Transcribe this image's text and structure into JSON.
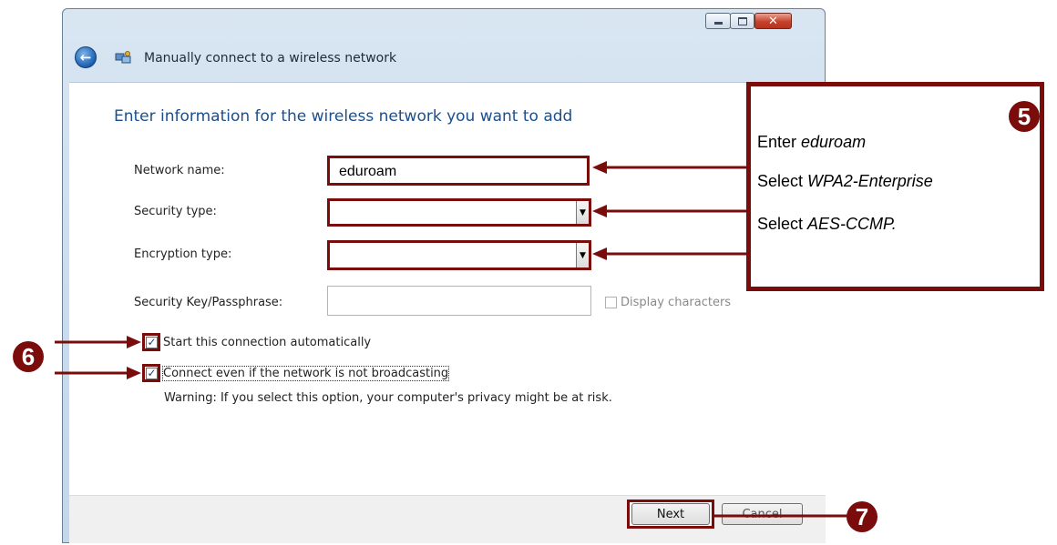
{
  "window": {
    "title": "Manually connect to a wireless network",
    "controls": {
      "minimize": "",
      "maximize": "",
      "close": "✕"
    }
  },
  "form": {
    "heading": "Enter information for the wireless network you want to add",
    "network_name_label": "Network name:",
    "network_name_value": "eduroam",
    "security_type_label": "Security type:",
    "security_type_value": "",
    "encryption_type_label": "Encryption type:",
    "encryption_type_value": "",
    "security_key_label": "Security Key/Passphrase:",
    "security_key_value": "",
    "display_characters_label": "Display characters",
    "display_characters_checked": false,
    "start_auto_label": "Start this connection automatically",
    "start_auto_checked": true,
    "connect_broadcast_label": "Connect even if the network is not broadcasting",
    "connect_broadcast_checked": true,
    "warning": "Warning: If you select this option, your computer's privacy might be at risk."
  },
  "buttons": {
    "next": "Next",
    "cancel": "Cancel"
  },
  "annotations": {
    "step5": "5",
    "step6": "6",
    "step7": "7",
    "callout": {
      "line1_prefix": "Enter ",
      "line1_value": "eduroam",
      "line2_prefix": "Select ",
      "line2_value": "WPA2-Enterprise",
      "line3_prefix": "Select ",
      "line3_value": "AES-CCMP."
    },
    "colors": {
      "annotation": "#7a0c0c",
      "heading": "#1b4f8c"
    }
  }
}
